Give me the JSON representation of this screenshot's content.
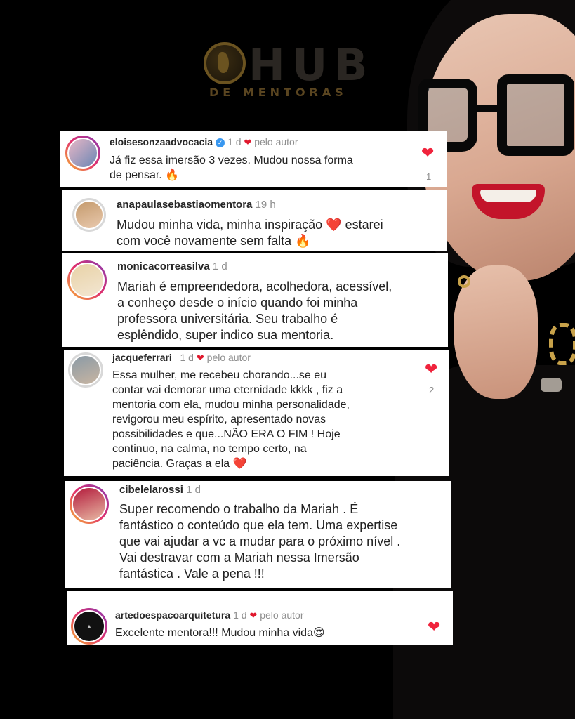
{
  "logo": {
    "word": "HUB",
    "subtitle": "DE MENTORAS"
  },
  "colors": {
    "background": "#000000",
    "card": "#ffffff",
    "heart": "#f0233c",
    "gold": "#6b5320"
  },
  "comments": [
    {
      "username": "eloisesonzaadvocacia",
      "verified": true,
      "time": "1 d",
      "liked_by_author": "pelo autor",
      "lines": [
        "Já fiz essa imersão 3 vezes. Mudou nossa forma",
        "de pensar. 🔥"
      ],
      "likes": "1"
    },
    {
      "username": "anapaulasebastiaomentora",
      "time": "19 h",
      "lines": [
        "Mudou minha vida, minha inspiração ❤️ estarei",
        "com você novamente sem falta 🔥"
      ]
    },
    {
      "username": "monicacorreasilva",
      "time": "1 d",
      "lines": [
        "Mariah é empreendedora, acolhedora, acessível,",
        "a conheço desde o início quando foi minha",
        "professora universitária. Seu trabalho é",
        "esplêndido, super indico sua mentoria."
      ]
    },
    {
      "username": "jacqueferrari_",
      "time": "1 d",
      "liked_by_author": "pelo autor",
      "lines": [
        "Essa mulher,  me recebeu chorando...se eu",
        "contar vai demorar uma eternidade  kkkk , fiz a",
        "mentoria com ela, mudou minha personalidade,",
        "revigorou meu espírito,  apresentado novas",
        "possibilidades e que...NÃO ERA O FIM ! Hoje",
        "continuo, na calma, no tempo certo,  na",
        "paciência.  Graças a ela ❤️"
      ],
      "likes": "2"
    },
    {
      "username": "cibelelarossi",
      "time": "1 d",
      "lines": [
        "Super recomendo o trabalho da Mariah . É",
        "fantástico o conteúdo que ela tem. Uma expertise",
        "que vai ajudar a vc a mudar para o próximo nível .",
        "Vai destravar com a Mariah nessa Imersão",
        "fantástica . Vale a pena !!!"
      ]
    },
    {
      "username": "artedoespacoarquitetura",
      "time": "1 d",
      "liked_by_author": "pelo autor",
      "lines": [
        "Excelente mentora!!! Mudou minha vida😍"
      ]
    }
  ]
}
